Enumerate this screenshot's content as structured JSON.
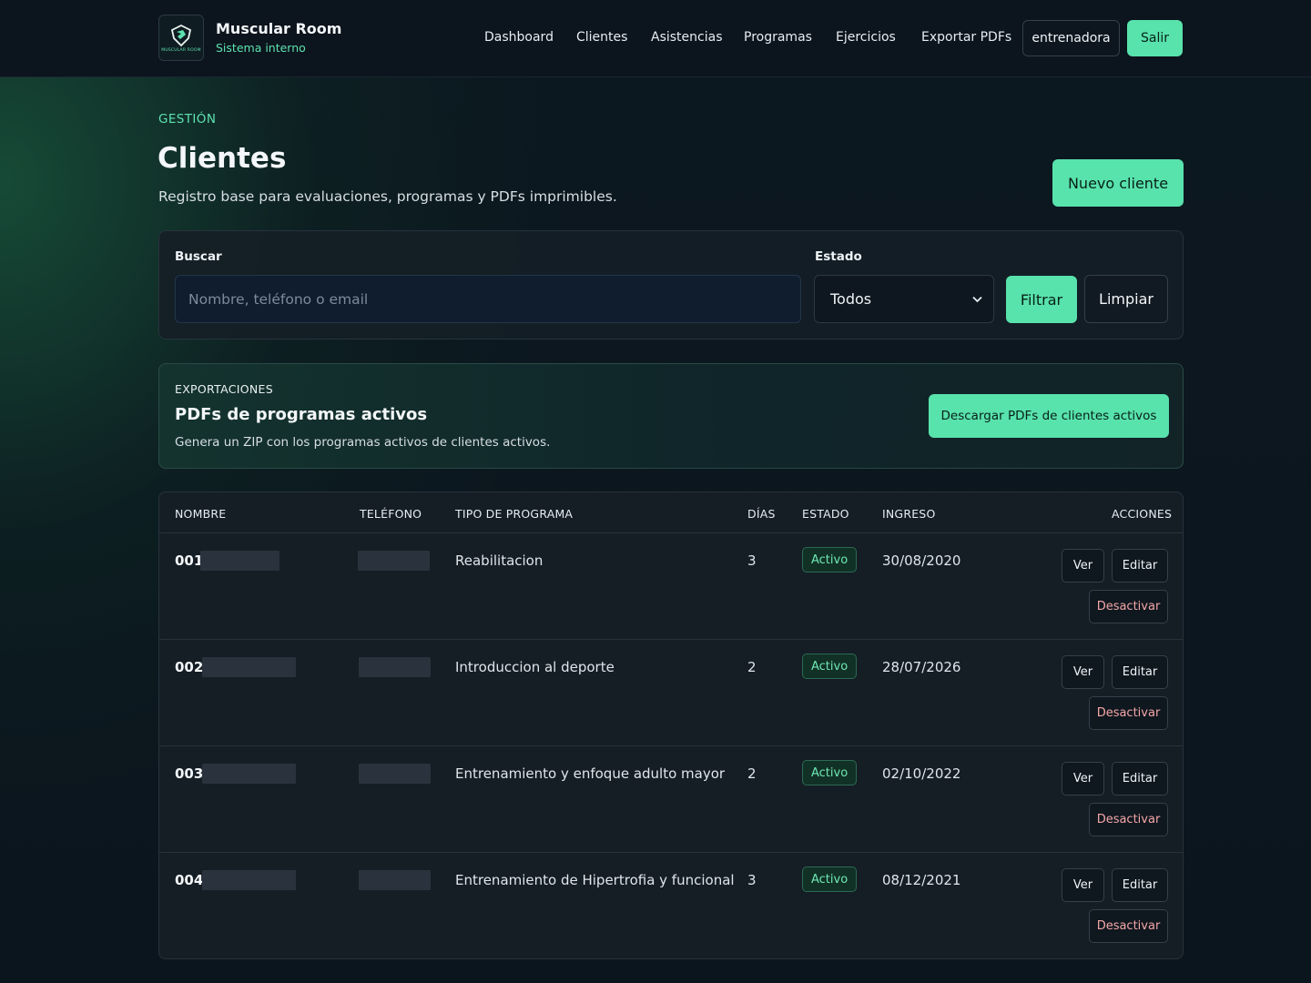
{
  "brand": {
    "logo_text": "MUSCULAR ROOM",
    "title": "Muscular Room",
    "subtitle": "Sistema interno"
  },
  "nav": {
    "links": [
      "Dashboard",
      "Clientes",
      "Asistencias",
      "Programas",
      "Ejercicios",
      "Exportar PDFs"
    ],
    "user": "entrenadora",
    "logout": "Salir"
  },
  "header": {
    "eyebrow": "GESTIÓN",
    "title": "Clientes",
    "description": "Registro base para evaluaciones, programas y PDFs imprimibles.",
    "new_button": "Nuevo cliente"
  },
  "filters": {
    "search_label": "Buscar",
    "search_placeholder": "Nombre, teléfono o email",
    "status_label": "Estado",
    "status_value": "Todos",
    "filter_button": "Filtrar",
    "clear_button": "Limpiar"
  },
  "export": {
    "eyebrow": "EXPORTACIONES",
    "title": "PDFs de programas activos",
    "description": "Genera un ZIP con los programas activos de clientes activos.",
    "button": "Descargar PDFs de clientes activos"
  },
  "table": {
    "headers": [
      "NOMBRE",
      "TELÉFONO",
      "TIPO DE PROGRAMA",
      "DÍAS",
      "ESTADO",
      "INGRESO",
      "ACCIONES"
    ],
    "rows": [
      {
        "id": "001",
        "program": "Reabilitacion",
        "days": "3",
        "status": "Activo",
        "date": "30/08/2020"
      },
      {
        "id": "002",
        "program": "Introduccion al deporte",
        "days": "2",
        "status": "Activo",
        "date": "28/07/2026"
      },
      {
        "id": "003",
        "program": "Entrenamiento y enfoque adulto mayor",
        "days": "2",
        "status": "Activo",
        "date": "02/10/2022"
      },
      {
        "id": "004",
        "program": "Entrenamiento de Hipertrofia y funcional",
        "days": "3",
        "status": "Activo",
        "date": "08/12/2021"
      }
    ],
    "actions": {
      "view": "Ver",
      "edit": "Editar",
      "deactivate": "Desactivar"
    }
  },
  "colors": {
    "accent": "#58e2ac",
    "background": "#0b141c",
    "danger_text": "#f4a7a7"
  }
}
